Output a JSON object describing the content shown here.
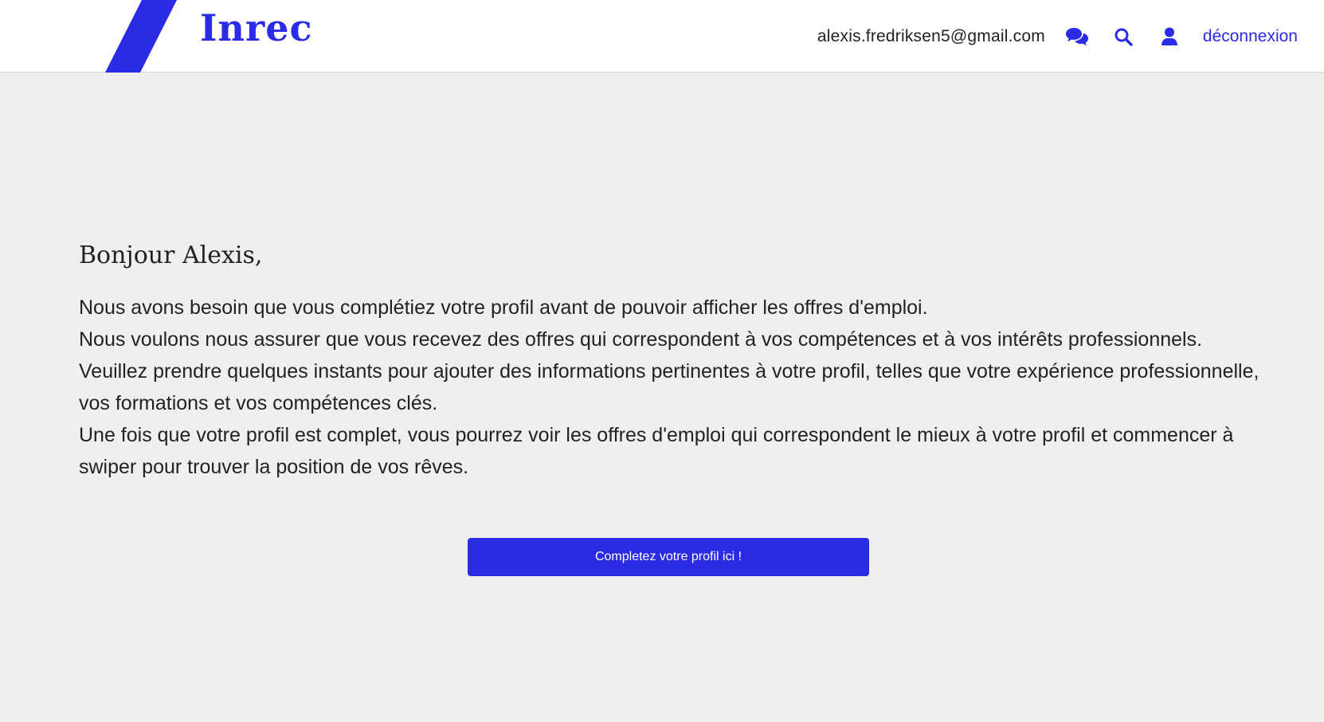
{
  "brand": {
    "name": "Inrec",
    "accent_color": "#2b2be6"
  },
  "header": {
    "email": "alexis.fredriksen5@gmail.com",
    "icons": [
      "chat-icon",
      "search-icon",
      "user-icon"
    ],
    "logout_label": "déconnexion"
  },
  "main": {
    "greeting": "Bonjour Alexis,",
    "paragraphs": [
      "Nous avons besoin que vous complétiez votre profil avant de pouvoir afficher les offres d'emploi.",
      "Nous voulons nous assurer que vous recevez des offres qui correspondent à vos compétences et à vos intérêts professionnels.",
      "Veuillez prendre quelques instants pour ajouter des informations pertinentes à votre profil, telles que votre expérience professionnelle, vos formations et vos compétences clés.",
      "Une fois que votre profil est complet, vous pourrez voir les offres d'emploi qui correspondent le mieux à votre profil et commencer à swiper pour trouver la position de vos rêves."
    ],
    "cta_label": "Completez votre profil ici !"
  }
}
